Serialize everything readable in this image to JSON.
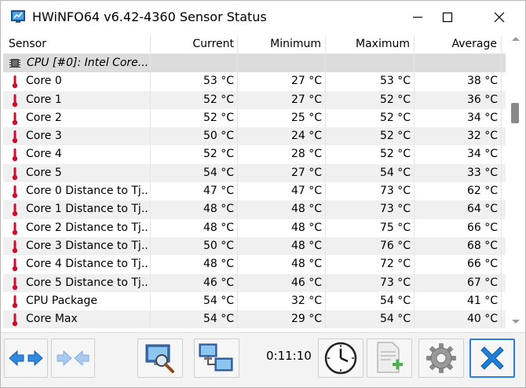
{
  "window": {
    "title": "HWiNFO64 v6.42-4360 Sensor Status"
  },
  "columns": [
    "Sensor",
    "Current",
    "Minimum",
    "Maximum",
    "Average"
  ],
  "group": {
    "label": "CPU [#0]: Intel Core..."
  },
  "rows": [
    {
      "name": "Core 0",
      "current": "53 °C",
      "minimum": "27 °C",
      "maximum": "53 °C",
      "average": "38 °C"
    },
    {
      "name": "Core 1",
      "current": "52 °C",
      "minimum": "27 °C",
      "maximum": "52 °C",
      "average": "36 °C"
    },
    {
      "name": "Core 2",
      "current": "52 °C",
      "minimum": "25 °C",
      "maximum": "52 °C",
      "average": "34 °C"
    },
    {
      "name": "Core 3",
      "current": "50 °C",
      "minimum": "24 °C",
      "maximum": "52 °C",
      "average": "32 °C"
    },
    {
      "name": "Core 4",
      "current": "52 °C",
      "minimum": "28 °C",
      "maximum": "52 °C",
      "average": "34 °C"
    },
    {
      "name": "Core 5",
      "current": "54 °C",
      "minimum": "27 °C",
      "maximum": "54 °C",
      "average": "33 °C"
    },
    {
      "name": "Core 0 Distance to Tj...",
      "current": "47 °C",
      "minimum": "47 °C",
      "maximum": "73 °C",
      "average": "62 °C"
    },
    {
      "name": "Core 1 Distance to Tj...",
      "current": "48 °C",
      "minimum": "48 °C",
      "maximum": "73 °C",
      "average": "64 °C"
    },
    {
      "name": "Core 2 Distance to Tj...",
      "current": "48 °C",
      "minimum": "48 °C",
      "maximum": "75 °C",
      "average": "66 °C"
    },
    {
      "name": "Core 3 Distance to Tj...",
      "current": "50 °C",
      "minimum": "48 °C",
      "maximum": "76 °C",
      "average": "68 °C"
    },
    {
      "name": "Core 4 Distance to Tj...",
      "current": "48 °C",
      "minimum": "48 °C",
      "maximum": "72 °C",
      "average": "66 °C"
    },
    {
      "name": "Core 5 Distance to Tj...",
      "current": "46 °C",
      "minimum": "46 °C",
      "maximum": "73 °C",
      "average": "67 °C"
    },
    {
      "name": "CPU Package",
      "current": "54 °C",
      "minimum": "32 °C",
      "maximum": "54 °C",
      "average": "41 °C"
    },
    {
      "name": "Core Max",
      "current": "54 °C",
      "minimum": "29 °C",
      "maximum": "54 °C",
      "average": "40 °C"
    }
  ],
  "toolbar": {
    "elapsed_time": "0:11:10",
    "buttons": [
      {
        "icon": "expand-arrows-icon",
        "name": "expand-button"
      },
      {
        "icon": "collapse-arrows-icon",
        "name": "collapse-button"
      },
      {
        "icon": "monitor-search-icon",
        "name": "monitor-button"
      },
      {
        "icon": "network-computers-icon",
        "name": "network-button"
      },
      {
        "icon": "clock-icon",
        "name": "reset-clock-button"
      },
      {
        "icon": "add-log-icon",
        "name": "log-button"
      },
      {
        "icon": "gear-icon",
        "name": "settings-button"
      },
      {
        "icon": "close-x-icon",
        "name": "close-sensors-button"
      }
    ]
  },
  "colors": {
    "row_alt": "#f0f0f0",
    "group_row": "#dcdcdc",
    "thermometer_red": "#c8102e",
    "active_button_border": "#2b7de0",
    "close_blue": "#1e7fd6"
  }
}
